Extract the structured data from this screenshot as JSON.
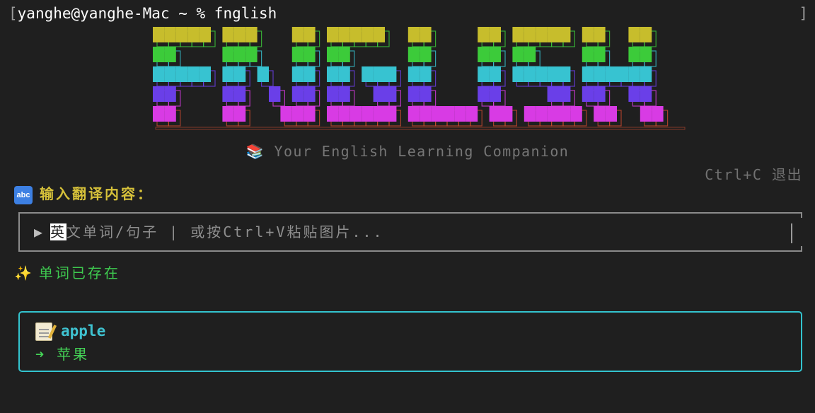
{
  "terminal": {
    "user": "yanghe",
    "host": "yanghe-Mac",
    "cwd": "~",
    "prompt_symbol": "%",
    "command": "fnglish",
    "prompt_text": "yanghe@yanghe-Mac ~ % fnglish"
  },
  "banner": {
    "logo_text": "FNGLISH",
    "logo_colors": [
      "#c7bd2c",
      "#3ccb3a",
      "#37c3d1",
      "#6a3fe8",
      "#d83be4",
      "#c7492e"
    ],
    "tagline_icon": "books-icon",
    "tagline": "Your English Learning Companion"
  },
  "quit_hint": "Ctrl+C 退出",
  "input_section": {
    "icon": "abc-input-icon",
    "icon_text": "abc",
    "title": "输入翻译内容：",
    "prompt_icon": "play-arrow-icon",
    "placeholder_first_char": "英",
    "placeholder_rest": "文单词/句子 | 或按Ctrl+V粘贴图片..."
  },
  "status": {
    "icon": "sparkles-icon",
    "text": "单词已存在"
  },
  "result": {
    "icon": "memo-icon",
    "word": "apple",
    "arrow": "➜",
    "meaning": "苹果"
  }
}
